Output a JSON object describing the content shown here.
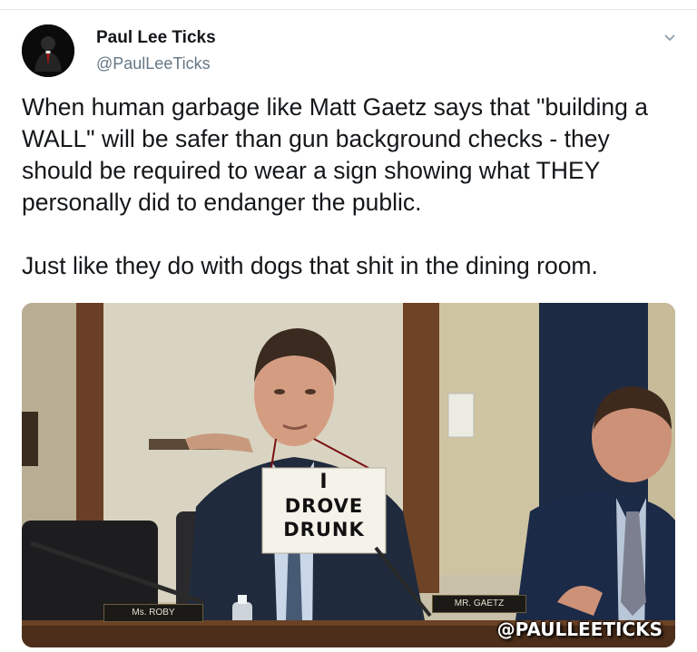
{
  "tweet": {
    "author_name": "Paul Lee Ticks",
    "author_handle": "@PaulLeeTicks",
    "paragraphs": [
      "When human garbage like Matt Gaetz says that \"building a WALL\" will be safer than gun background checks - they should be required to wear a sign showing what THEY personally did to endanger the public.",
      "Just like they do with dogs that shit in the dining room."
    ]
  },
  "media": {
    "sign_line1": "I",
    "sign_line2": "DROVE",
    "sign_line3": "DRUNK",
    "nameplate_left": "Ms. ROBY",
    "nameplate_center": "MR. GAETZ",
    "watermark": "@PAULLEETICKS"
  },
  "icons": {
    "menu": "chevron-down-icon",
    "avatar": "avatar-silhouette"
  }
}
